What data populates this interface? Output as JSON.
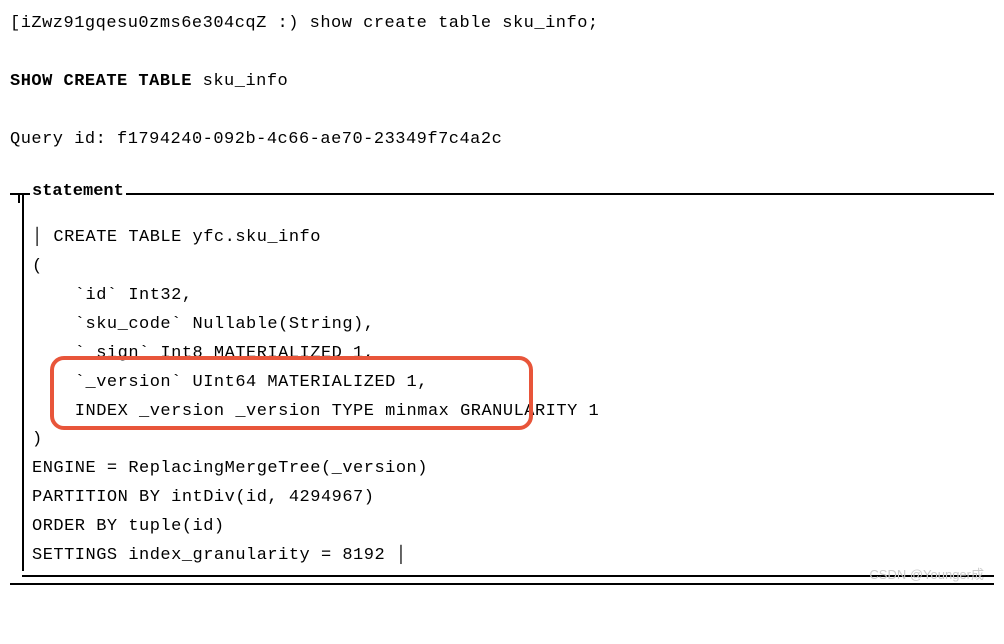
{
  "prompt": "[iZwz91gqesu0zms6e304cqZ :) show create table sku_info;",
  "echo_bold": "SHOW CREATE TABLE",
  "echo_rest": " sku_info",
  "query_id_label": "Query id: ",
  "query_id": "f1794240-092b-4c66-ae70-23349f7c4a2c",
  "box_label": "statement",
  "lines": {
    "l1": "│ CREATE TABLE yfc.sku_info",
    "l2": "(",
    "l3": "    `id` Int32,",
    "l4": "    `sku_code` Nullable(String),",
    "l5": "    `_sign` Int8 MATERIALIZED 1,",
    "l6": "    `_version` UInt64 MATERIALIZED 1,",
    "l7": "    INDEX _version _version TYPE minmax GRANULARITY 1",
    "l8": ")",
    "l9": "ENGINE = ReplacingMergeTree(_version)",
    "l10": "PARTITION BY intDiv(id, 4294967)",
    "l11": "ORDER BY tuple(id)",
    "l12": "SETTINGS index_granularity = 8192 │"
  },
  "watermark": "CSDN @Younger成"
}
